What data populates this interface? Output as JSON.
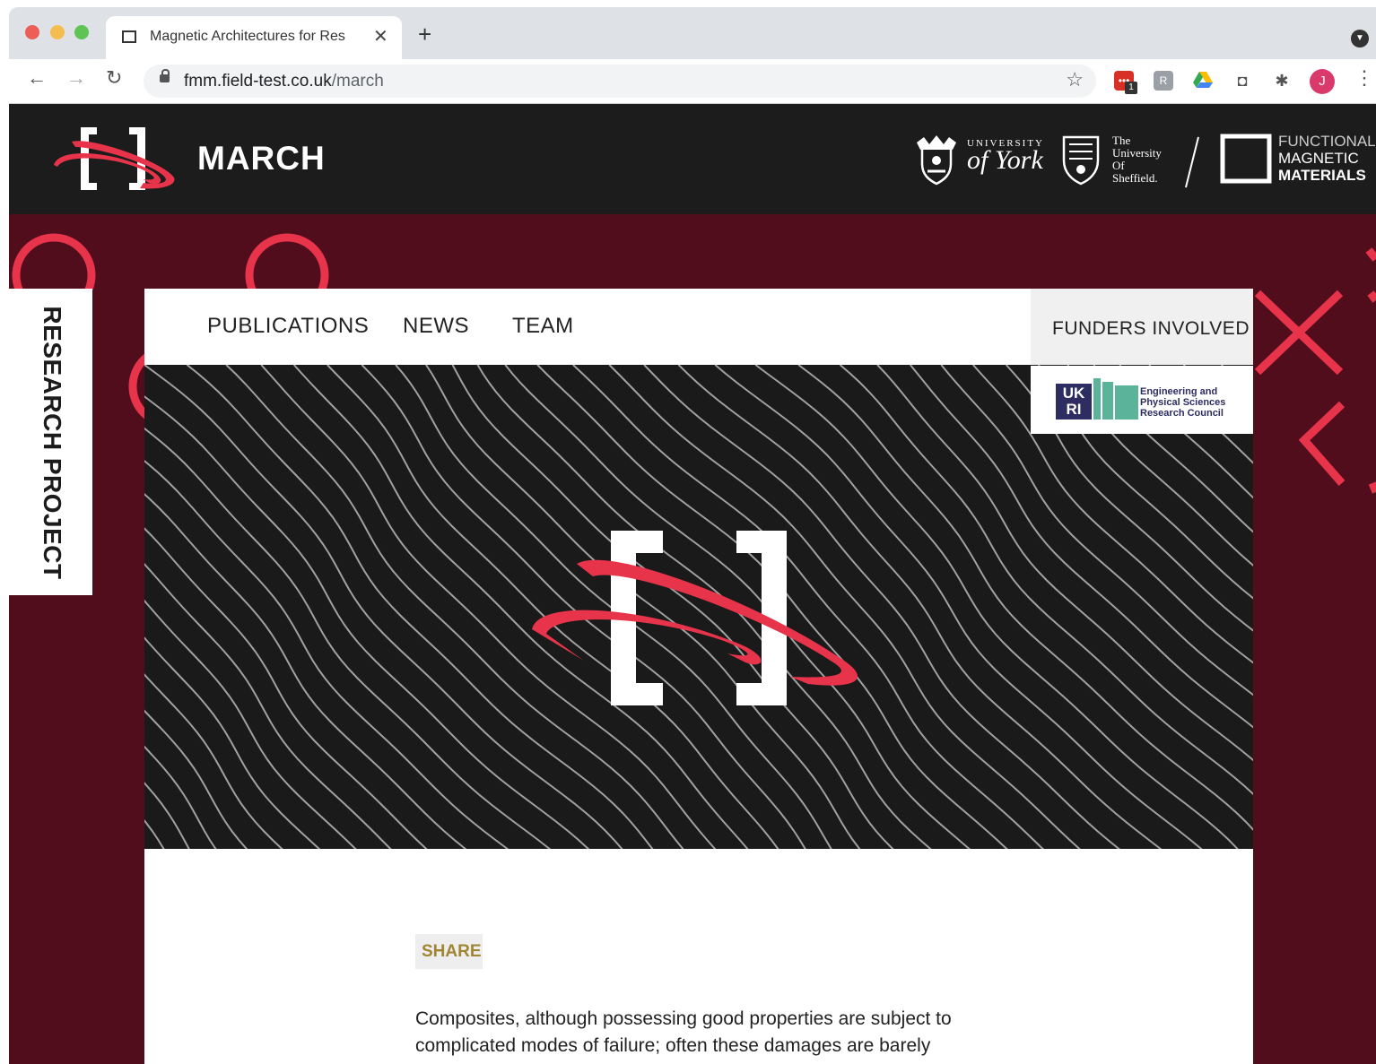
{
  "browser": {
    "tab_title": "Magnetic Architectures for Res",
    "url_host": "fmm.field-test.co.uk",
    "url_path": "/march",
    "profile_initial": "J",
    "extension_badge": "1"
  },
  "header": {
    "site_title": "MARCH",
    "york": {
      "small": "UNIVERSITY",
      "big": "of York"
    },
    "sheffield": [
      "The",
      "University",
      "Of",
      "Sheffield."
    ],
    "fmm": [
      "FUNCTIONAL",
      "MAGNETIC",
      "MATERIALS"
    ]
  },
  "side_tab": {
    "label": "RESEARCH PROJECT"
  },
  "nav": {
    "items": [
      "PUBLICATIONS",
      "NEWS",
      "TEAM"
    ],
    "funders_label": "FUNDERS INVOLVED"
  },
  "funder": {
    "ukri_top": "UK",
    "ukri_bottom": "RI",
    "lines": [
      "Engineering and",
      "Physical Sciences",
      "Research Council"
    ]
  },
  "content": {
    "share_label": "SHARE",
    "paragraph": "Composites, although possessing good properties are subject to complicated modes of failure; often these damages are barely"
  },
  "colors": {
    "accent": "#e8344b",
    "maroon": "#520d1c",
    "header_bg": "#1c1c1c",
    "share_text": "#a08534"
  }
}
